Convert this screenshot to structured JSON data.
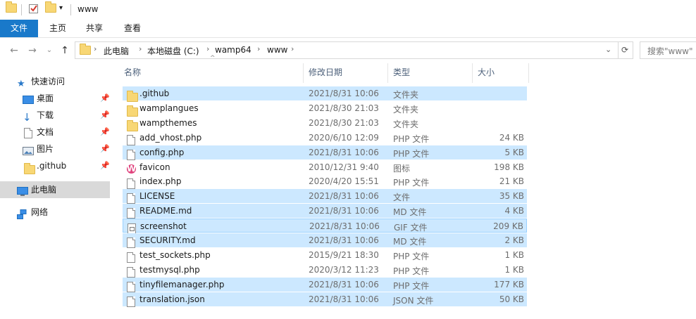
{
  "window": {
    "title": "www"
  },
  "ribbon": {
    "tabs": [
      "文件",
      "主页",
      "共享",
      "查看"
    ]
  },
  "address": {
    "segments": [
      "此电脑",
      "本地磁盘 (C:)",
      "wamp64",
      "www"
    ],
    "search_placeholder": "搜索\"www\""
  },
  "nav": {
    "quick_access": "快速访问",
    "items": [
      {
        "label": "桌面",
        "icon": "desktop-icon",
        "pinned": true
      },
      {
        "label": "下载",
        "icon": "download-icon",
        "pinned": true
      },
      {
        "label": "文档",
        "icon": "document-icon",
        "pinned": true
      },
      {
        "label": "图片",
        "icon": "picture-icon",
        "pinned": true
      },
      {
        "label": ".github",
        "icon": "folder-icon",
        "pinned": true
      }
    ],
    "this_pc": "此电脑",
    "network": "网络"
  },
  "columns": {
    "name": "名称",
    "date": "修改日期",
    "type": "类型",
    "size": "大小"
  },
  "files": [
    {
      "name": ".github",
      "date": "2021/8/31 10:06",
      "type": "文件夹",
      "size": "",
      "icon": "folder-icon",
      "selected": true
    },
    {
      "name": "wamplangues",
      "date": "2021/8/30 21:03",
      "type": "文件夹",
      "size": "",
      "icon": "folder-icon",
      "selected": false
    },
    {
      "name": "wampthemes",
      "date": "2021/8/30 21:03",
      "type": "文件夹",
      "size": "",
      "icon": "folder-icon",
      "selected": false
    },
    {
      "name": "add_vhost.php",
      "date": "2020/6/10 12:09",
      "type": "PHP 文件",
      "size": "24 KB",
      "icon": "file-icon",
      "selected": false
    },
    {
      "name": "config.php",
      "date": "2021/8/31 10:06",
      "type": "PHP 文件",
      "size": "5 KB",
      "icon": "file-icon",
      "selected": true
    },
    {
      "name": "favicon",
      "date": "2010/12/31 9:40",
      "type": "图标",
      "size": "198 KB",
      "icon": "wamp-icon",
      "selected": false
    },
    {
      "name": "index.php",
      "date": "2020/4/20 15:51",
      "type": "PHP 文件",
      "size": "21 KB",
      "icon": "file-icon",
      "selected": false
    },
    {
      "name": "LICENSE",
      "date": "2021/8/31 10:06",
      "type": "文件",
      "size": "35 KB",
      "icon": "file-icon",
      "selected": true
    },
    {
      "name": "README.md",
      "date": "2021/8/31 10:06",
      "type": "MD 文件",
      "size": "4 KB",
      "icon": "file-icon",
      "selected": true
    },
    {
      "name": "screenshot",
      "date": "2021/8/31 10:06",
      "type": "GIF 文件",
      "size": "209 KB",
      "icon": "image-file-icon",
      "selected": true,
      "focused": true
    },
    {
      "name": "SECURITY.md",
      "date": "2021/8/31 10:06",
      "type": "MD 文件",
      "size": "2 KB",
      "icon": "file-icon",
      "selected": true
    },
    {
      "name": "test_sockets.php",
      "date": "2015/9/21 18:30",
      "type": "PHP 文件",
      "size": "1 KB",
      "icon": "file-icon",
      "selected": false
    },
    {
      "name": "testmysql.php",
      "date": "2020/3/12 11:23",
      "type": "PHP 文件",
      "size": "1 KB",
      "icon": "file-icon",
      "selected": false
    },
    {
      "name": "tinyfilemanager.php",
      "date": "2021/8/31 10:06",
      "type": "PHP 文件",
      "size": "177 KB",
      "icon": "file-icon",
      "selected": true
    },
    {
      "name": "translation.json",
      "date": "2021/8/31 10:06",
      "type": "JSON 文件",
      "size": "50 KB",
      "icon": "file-icon",
      "selected": true
    }
  ],
  "colors": {
    "accent": "#1979ca",
    "selection": "#cce8ff",
    "folder": "#f8d775"
  }
}
